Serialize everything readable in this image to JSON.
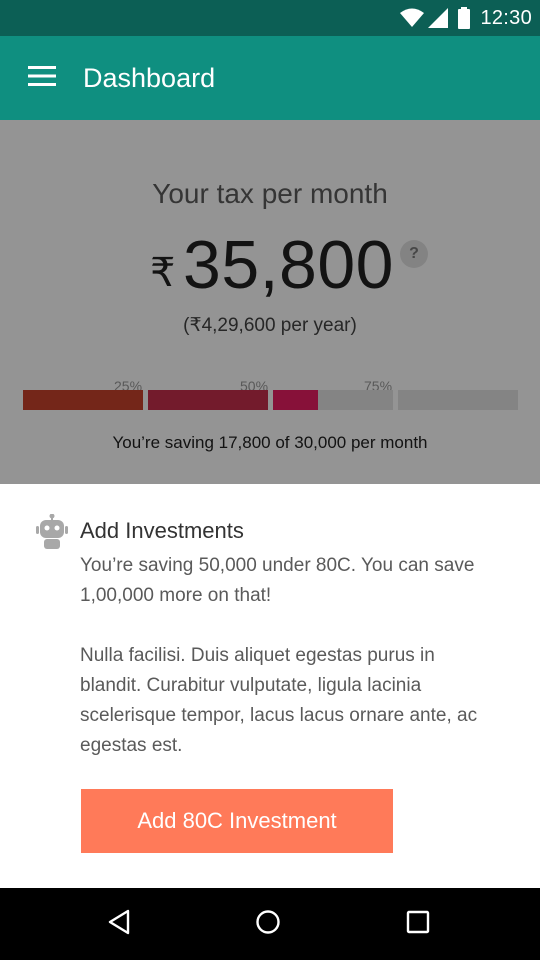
{
  "status_bar": {
    "time": "12:30",
    "icons": [
      "wifi-icon",
      "cell-signal-icon",
      "battery-icon"
    ]
  },
  "app_bar": {
    "title": "Dashboard",
    "menu_icon": "hamburger-menu-icon"
  },
  "summary": {
    "label": "Your tax per month",
    "currency_symbol": "₹",
    "amount": "35,800",
    "help_label": "?",
    "per_year": "(₹4,29,600 per year)"
  },
  "progress": {
    "markers": [
      "25%",
      "50%",
      "75%"
    ],
    "saved": 17800,
    "target": 30000,
    "saving_text": "You’re saving 17,800 of 30,000 per month"
  },
  "sheet": {
    "icon": "robot-icon",
    "title": "Add Investments",
    "text1": "You’re saving 50,000 under 80C. You can save 1,00,000 more on that!",
    "text2": "Nulla facilisi. Duis aliquet egestas purus in blandit. Curabitur vulputate, ligula lacinia scelerisque tempor, lacus lacus ornare ante, ac egestas est.",
    "button_label": "Add 80C Investment"
  },
  "nav_bar": {
    "icons": [
      "back-icon",
      "home-icon",
      "recents-icon"
    ]
  },
  "colors": {
    "status_bar": "#0c5f55",
    "app_bar": "#0f8f80",
    "accent": "#ff7a59",
    "seg1": "#c8432c",
    "seg2": "#c72f4c",
    "seg3": "#e91e63",
    "track": "#e4e4e4"
  }
}
